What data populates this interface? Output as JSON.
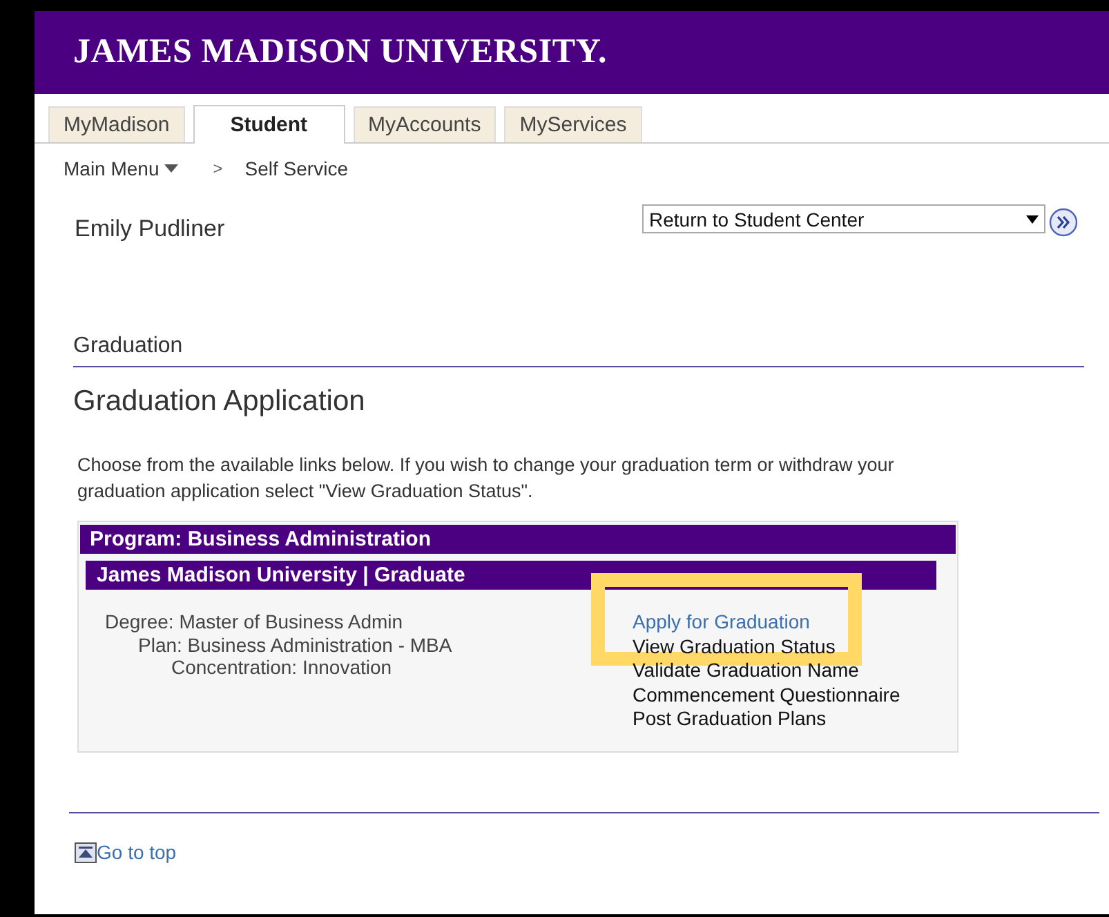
{
  "header": {
    "logo": "JAMES MADISON UNIVERSITY."
  },
  "tabs": [
    {
      "label": "MyMadison",
      "selected": false
    },
    {
      "label": "Student",
      "selected": true
    },
    {
      "label": "MyAccounts",
      "selected": false
    },
    {
      "label": "MyServices",
      "selected": false
    }
  ],
  "breadcrumb": {
    "menu": "Main Menu",
    "separator": ">",
    "current": "Self Service"
  },
  "user_name": "Emily Pudliner",
  "navigation_select": {
    "value": "Return to Student Center"
  },
  "section_title": "Graduation",
  "page_title": "Graduation Application",
  "instructions": "Choose from the available links below. If you wish to change your graduation term or withdraw your graduation application select \"View Graduation Status\".",
  "program": {
    "title": "Program: Business Administration",
    "subtitle": "James Madison University | Graduate",
    "details": [
      "Degree: Master of Business Admin",
      "Plan: Business Administration - MBA",
      "Concentration: Innovation"
    ],
    "links": [
      {
        "label": "Apply for Graduation",
        "kind": "link",
        "highlighted": true
      },
      {
        "label": "View Graduation Status",
        "kind": "plain",
        "highlighted": false
      },
      {
        "label": "Validate Graduation Name",
        "kind": "plain",
        "highlighted": false
      },
      {
        "label": "Commencement Questionnaire",
        "kind": "plain",
        "highlighted": false
      },
      {
        "label": "Post Graduation Plans",
        "kind": "plain",
        "highlighted": false
      }
    ]
  },
  "go_to_top": "Go to top"
}
